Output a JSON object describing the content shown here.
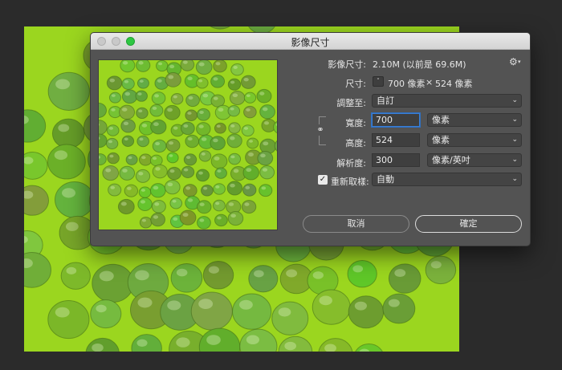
{
  "dialog": {
    "title": "影像尺寸",
    "image_size": {
      "label": "影像尺寸:",
      "value": "2.10M (以前是 69.6M)"
    },
    "dimensions": {
      "label": "尺寸:",
      "width_value": "700 像素",
      "times": "×",
      "height_value": "524 像素"
    },
    "fit_to": {
      "label": "調整至:",
      "value": "自訂"
    },
    "width": {
      "label": "寬度:",
      "value": "700",
      "unit": "像素"
    },
    "height": {
      "label": "高度:",
      "value": "524",
      "unit": "像素"
    },
    "resolution": {
      "label": "解析度:",
      "value": "300",
      "unit": "像素/英吋"
    },
    "resample": {
      "label": "重新取樣:",
      "checked": true,
      "value": "自動"
    },
    "buttons": {
      "cancel": "取消",
      "ok": "確定"
    }
  },
  "icons": {
    "gear": "gear-icon",
    "link": "chain-link-icon",
    "chevron": "chevron-updown-icon",
    "check": "checkmark-icon"
  },
  "colors": {
    "image_green": "#9bd61f",
    "dialog_bg": "#535353",
    "focus_blue": "#3a7fd6",
    "zoom_green": "#2ec742"
  }
}
